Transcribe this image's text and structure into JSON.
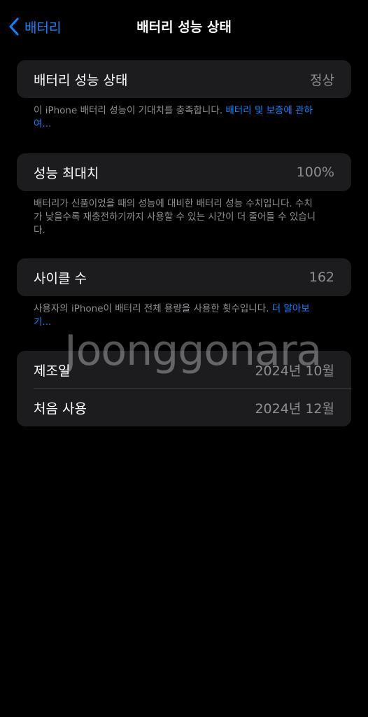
{
  "nav": {
    "back_label": "배터리",
    "title": "배터리 성능 상태"
  },
  "health": {
    "label": "배터리 성능 상태",
    "value": "정상",
    "footnote_text": "이 iPhone 배터리 성능이 기대치를 충족합니다. ",
    "footnote_link": "배터리 및 보증에 관하여..."
  },
  "max_capacity": {
    "label": "성능 최대치",
    "value": "100%",
    "footnote_text": "배터리가 신품이었을 때의 성능에 대비한 배터리 성능 수치입니다. 수치가 낮을수록 재충전하기까지 사용할 수 있는 시간이 더 줄어들 수 있습니다."
  },
  "cycle_count": {
    "label": "사이클 수",
    "value": "162",
    "footnote_text": "사용자의 iPhone이 배터리 전체 용량을 사용한 횟수입니다. ",
    "footnote_link": "더 알아보기..."
  },
  "dates": {
    "manufacture_label": "제조일",
    "manufacture_value": "2024년 10월",
    "first_use_label": "처음 사용",
    "first_use_value": "2024년 12월"
  },
  "watermark": "Joonggonara",
  "colors": {
    "accent": "#0a84ff",
    "background": "#000000",
    "card": "#1c1c1e",
    "secondary_text": "#8e8e93"
  },
  "icons": {
    "back": "chevron-left-icon"
  }
}
